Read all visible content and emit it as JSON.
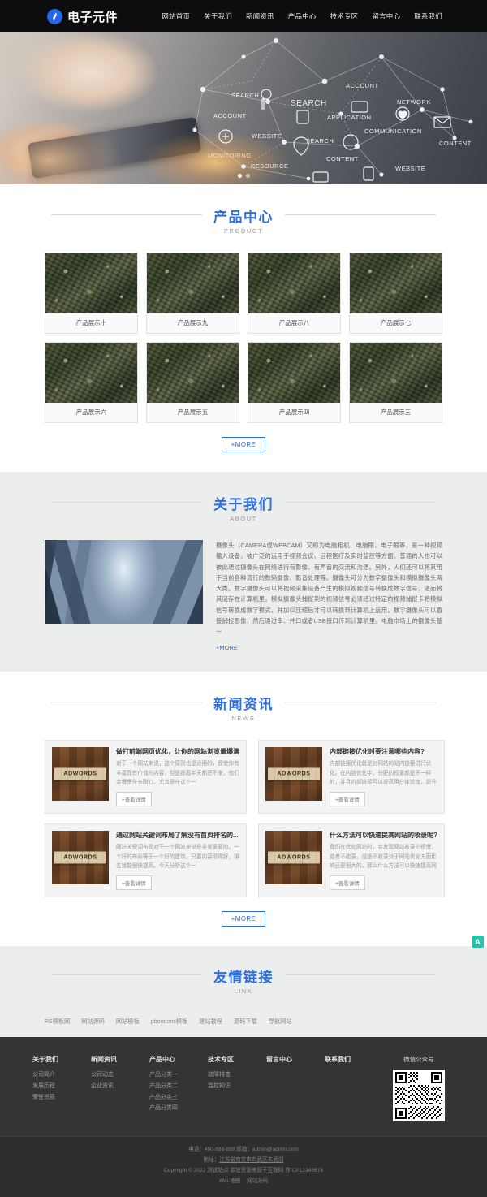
{
  "header": {
    "logo_text": "电子元件",
    "logo_icon": "flame-circle-icon",
    "nav": [
      {
        "label": "网站首页"
      },
      {
        "label": "关于我们"
      },
      {
        "label": "新闻资讯"
      },
      {
        "label": "产品中心"
      },
      {
        "label": "技术专区"
      },
      {
        "label": "留言中心"
      },
      {
        "label": "联系我们"
      }
    ]
  },
  "hero": {
    "labels": [
      "SEARCH",
      "ACCOUNT",
      "SEARCH",
      "NETWORK",
      "ACCOUNT",
      "APPLICATION",
      "WEBSITE",
      "COMMUNICATION",
      "SEARCH",
      "CONTENT",
      "MONITORING",
      "RESOURCE",
      "CONTENT",
      "WEBSITE",
      "SEARCH",
      "WEBSITE"
    ],
    "slides": [
      "slide-1",
      "slide-2"
    ],
    "active_slide": 1
  },
  "products": {
    "title_cn": "产品中心",
    "title_en": "PRODUCT",
    "items": [
      {
        "name": "产品展示十"
      },
      {
        "name": "产品展示九"
      },
      {
        "name": "产品展示八"
      },
      {
        "name": "产品展示七"
      },
      {
        "name": "产品展示六"
      },
      {
        "name": "产品展示五"
      },
      {
        "name": "产品展示四"
      },
      {
        "name": "产品展示三"
      }
    ],
    "more_label": "+MORE"
  },
  "about": {
    "title_cn": "关于我们",
    "title_en": "ABOUT",
    "body": "摄像头（CAMERA或WEBCAM）又称为电脑相机、电脑眼、电子眼等，是一种视频输入设备，被广泛的运用于视频会议、远程医疗及实时监控等方面。普通的人也可以被此通过摄像头在网络进行有影像、有声音的交流和沟通。另外，人们还可以将其用于当前各种流行的数码摄像、影音处理等。摄像头可分为数字摄像头和模拟摄像头两大类。数字摄像头可以将视频采集设备产生的模拟视频信号转换成数字信号，进而将其储存在计算机里。模拟摄像头捕捉到的视频信号必须经过特定的视频捕捉卡将模拟信号转换成数字模式，并加以压缩后才可以转换到计算机上运用。数字摄像头可以直接捕捉影像，然后通过串、并口或者USB接口传到计算机里。电脑市场上的摄像头基一",
    "more_label": "+MORE"
  },
  "news": {
    "title_cn": "新闻资讯",
    "title_en": "NEWS",
    "items": [
      {
        "title": "做打前端网页优化，让你的网站浏览量爆满",
        "desc": "对于一个网站来说，这个原则也是适用的，即使你有丰富而有价值的内容，但是跟着半天都还不来，他们会慢慢失去耐心，尤其是在这个一",
        "btn": "+查看详情",
        "thumb_text": "ADWORDS"
      },
      {
        "title": "内部链接优化时要注意哪些内容?",
        "desc": "内部链接优化就是对网站的站内链接进行优化。在内链优化中，分配的权重都是不一样的，并且内部链接可以提高用户体验度，提升访问一",
        "btn": "+查看详情",
        "thumb_text": "ADWORDS"
      },
      {
        "title": "通过网站关键词布局了解没有首页排名的...",
        "desc": "网站关键词布局对于一个网站来说是非常重要的。一个好的布局等于一个好的建筑。只要内容填得好，排名就能很快提高。今天分析这个一",
        "btn": "+查看详情",
        "thumb_text": "ADWORDS"
      },
      {
        "title": "什么方法可以快速提高网站的收录呢?",
        "desc": "我们在优化网站时，会发现网站收录的很慢，或者不收录。但是不收录对于网站优化方面影响还是很大的。那么什么方法可以快速提高网一",
        "btn": "+查看详情",
        "thumb_text": "ADWORDS"
      }
    ],
    "more_label": "+MORE"
  },
  "links": {
    "title_cn": "友情链接",
    "title_en": "LINK",
    "items": [
      {
        "label": "PS模板网"
      },
      {
        "label": "网站源码"
      },
      {
        "label": "网站模板"
      },
      {
        "label": "pbootcms模板"
      },
      {
        "label": "建站教程"
      },
      {
        "label": "源码下载"
      },
      {
        "label": "导航网站"
      }
    ]
  },
  "footer": {
    "columns": [
      {
        "title": "关于我们",
        "items": [
          "公司简介",
          "发展历程",
          "荣誉资质"
        ]
      },
      {
        "title": "新闻资讯",
        "items": [
          "公司动态",
          "企业资讯"
        ]
      },
      {
        "title": "产品中心",
        "items": [
          "产品分类一",
          "产品分类二",
          "产品分类三",
          "产品分类四"
        ]
      },
      {
        "title": "技术专区",
        "items": [
          "故障排查",
          "监控知识"
        ]
      },
      {
        "title": "留言中心",
        "items": []
      },
      {
        "title": "联系我们",
        "items": []
      }
    ],
    "qr_label": "微信公众号",
    "qr_icon": "qr-code-icon",
    "copyright": {
      "line1": "电话：400-888-888 邮箱：admin@admin.com",
      "line2_prefix": "地址：",
      "line2_link": "江苏省南京市玄武区玄武湖",
      "line3": "Copyright © 2022 测试站点 本站资源来源于互联网 苏ICP12345678",
      "line4_a": "XML地图",
      "line4_b": "网站源码"
    }
  },
  "float_button": {
    "label": "A",
    "icon": "accessibility-float-icon"
  }
}
